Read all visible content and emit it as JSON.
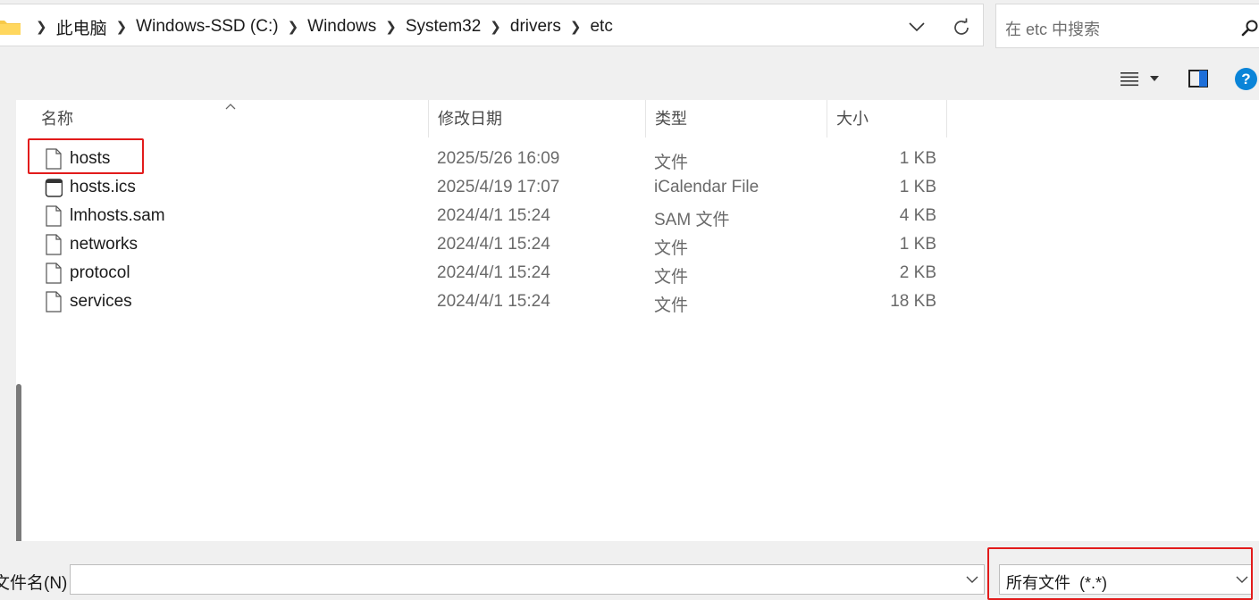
{
  "address": {
    "crumbs": [
      "此电脑",
      "Windows-SSD (C:)",
      "Windows",
      "System32",
      "drivers",
      "etc"
    ],
    "separator": ">"
  },
  "search": {
    "placeholder": "在 etc 中搜索"
  },
  "toolbar": {
    "help_label": "?"
  },
  "columns": {
    "name": "名称",
    "date": "修改日期",
    "type": "类型",
    "size": "大小"
  },
  "files": [
    {
      "name": "hosts",
      "date": "2025/5/26 16:09",
      "type": "文件",
      "size": "1 KB",
      "icon": "file-icon"
    },
    {
      "name": "hosts.ics",
      "date": "2025/4/19 17:07",
      "type": "iCalendar File",
      "size": "1 KB",
      "icon": "calendar-file-icon"
    },
    {
      "name": "lmhosts.sam",
      "date": "2024/4/1 15:24",
      "type": "SAM 文件",
      "size": "4 KB",
      "icon": "file-icon"
    },
    {
      "name": "networks",
      "date": "2024/4/1 15:24",
      "type": "文件",
      "size": "1 KB",
      "icon": "file-icon"
    },
    {
      "name": "protocol",
      "date": "2024/4/1 15:24",
      "type": "文件",
      "size": "2 KB",
      "icon": "file-icon"
    },
    {
      "name": "services",
      "date": "2024/4/1 15:24",
      "type": "文件",
      "size": "18 KB",
      "icon": "file-icon"
    }
  ],
  "bottom": {
    "filename_label": "文件名(N):",
    "filename_value": "",
    "filetype_value": "所有文件  (*.*)"
  },
  "colors": {
    "highlight": "#e21b1b",
    "help": "#0a84d8"
  }
}
